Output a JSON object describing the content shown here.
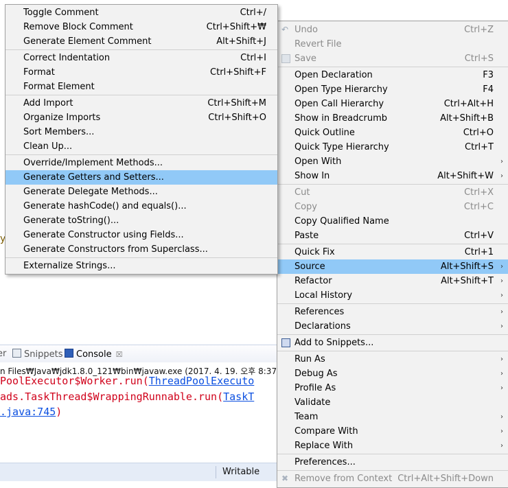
{
  "source_menu": {
    "groups": [
      [
        {
          "label": "Toggle Comment",
          "shortcut": "Ctrl+/"
        },
        {
          "label": "Remove Block Comment",
          "shortcut": "Ctrl+Shift+₩"
        },
        {
          "label": "Generate Element Comment",
          "shortcut": "Alt+Shift+J"
        }
      ],
      [
        {
          "label": "Correct Indentation",
          "shortcut": "Ctrl+I"
        },
        {
          "label": "Format",
          "shortcut": "Ctrl+Shift+F"
        },
        {
          "label": "Format Element",
          "shortcut": ""
        }
      ],
      [
        {
          "label": "Add Import",
          "shortcut": "Ctrl+Shift+M"
        },
        {
          "label": "Organize Imports",
          "shortcut": "Ctrl+Shift+O"
        },
        {
          "label": "Sort Members...",
          "shortcut": ""
        },
        {
          "label": "Clean Up...",
          "shortcut": ""
        }
      ],
      [
        {
          "label": "Override/Implement Methods...",
          "shortcut": ""
        },
        {
          "label": "Generate Getters and Setters...",
          "shortcut": "",
          "highlighted": true
        },
        {
          "label": "Generate Delegate Methods...",
          "shortcut": ""
        },
        {
          "label": "Generate hashCode() and equals()...",
          "shortcut": ""
        },
        {
          "label": "Generate toString()...",
          "shortcut": ""
        },
        {
          "label": "Generate Constructor using Fields...",
          "shortcut": ""
        },
        {
          "label": "Generate Constructors from Superclass...",
          "shortcut": ""
        }
      ],
      [
        {
          "label": "Externalize Strings...",
          "shortcut": ""
        }
      ]
    ]
  },
  "context_menu": {
    "groups": [
      [
        {
          "label": "Undo",
          "shortcut": "Ctrl+Z",
          "disabled": true,
          "icon": "undo-icon"
        },
        {
          "label": "Revert File",
          "shortcut": "",
          "disabled": true
        },
        {
          "label": "Save",
          "shortcut": "Ctrl+S",
          "disabled": true,
          "icon": "save-icon"
        }
      ],
      [
        {
          "label": "Open Declaration",
          "shortcut": "F3"
        },
        {
          "label": "Open Type Hierarchy",
          "shortcut": "F4"
        },
        {
          "label": "Open Call Hierarchy",
          "shortcut": "Ctrl+Alt+H"
        },
        {
          "label": "Show in Breadcrumb",
          "shortcut": "Alt+Shift+B"
        },
        {
          "label": "Quick Outline",
          "shortcut": "Ctrl+O"
        },
        {
          "label": "Quick Type Hierarchy",
          "shortcut": "Ctrl+T"
        },
        {
          "label": "Open With",
          "shortcut": "",
          "submenu": true
        },
        {
          "label": "Show In",
          "shortcut": "Alt+Shift+W",
          "submenu": true
        }
      ],
      [
        {
          "label": "Cut",
          "shortcut": "Ctrl+X",
          "disabled": true
        },
        {
          "label": "Copy",
          "shortcut": "Ctrl+C",
          "disabled": true
        },
        {
          "label": "Copy Qualified Name",
          "shortcut": ""
        },
        {
          "label": "Paste",
          "shortcut": "Ctrl+V"
        }
      ],
      [
        {
          "label": "Quick Fix",
          "shortcut": "Ctrl+1"
        },
        {
          "label": "Source",
          "shortcut": "Alt+Shift+S",
          "submenu": true,
          "highlighted": true
        },
        {
          "label": "Refactor",
          "shortcut": "Alt+Shift+T",
          "submenu": true
        },
        {
          "label": "Local History",
          "shortcut": "",
          "submenu": true
        }
      ],
      [
        {
          "label": "References",
          "shortcut": "",
          "submenu": true
        },
        {
          "label": "Declarations",
          "shortcut": "",
          "submenu": true
        }
      ],
      [
        {
          "label": "Add to Snippets...",
          "shortcut": "",
          "icon": "snippets-icon"
        }
      ],
      [
        {
          "label": "Run As",
          "shortcut": "",
          "submenu": true
        },
        {
          "label": "Debug As",
          "shortcut": "",
          "submenu": true
        },
        {
          "label": "Profile As",
          "shortcut": "",
          "submenu": true
        },
        {
          "label": "Validate",
          "shortcut": ""
        },
        {
          "label": "Team",
          "shortcut": "",
          "submenu": true
        },
        {
          "label": "Compare With",
          "shortcut": "",
          "submenu": true
        },
        {
          "label": "Replace With",
          "shortcut": "",
          "submenu": true
        }
      ],
      [
        {
          "label": "Preferences...",
          "shortcut": ""
        }
      ],
      [
        {
          "label": "Remove from Context",
          "shortcut": "Ctrl+Alt+Shift+Down",
          "disabled": true,
          "icon": "remove-context-icon"
        }
      ]
    ]
  },
  "views": {
    "tabs": [
      {
        "label": "er"
      },
      {
        "label": "Snippets"
      },
      {
        "label": "Console",
        "close": "☒"
      }
    ]
  },
  "console": {
    "header": "n Files₩Java₩jdk1.8.0_121₩bin₩javaw.exe (2017. 4. 19. 오후 8:37",
    "line1_text": "PoolExecutor$Worker.run(",
    "line1_link": "ThreadPoolExecuto",
    "line2_text": "ads.TaskThread$WrappingRunnable.run(",
    "line2_link": "TaskT",
    "line3_link": ".java:745",
    "line3_text": ")"
  },
  "editor": {
    "stray_char": "y"
  },
  "status": {
    "writable": "Writable"
  },
  "colors": {
    "highlight": "#91c9f7",
    "menu_bg": "#f2f2f2",
    "console_error": "#d0021b",
    "console_link": "#0b4fe0"
  }
}
